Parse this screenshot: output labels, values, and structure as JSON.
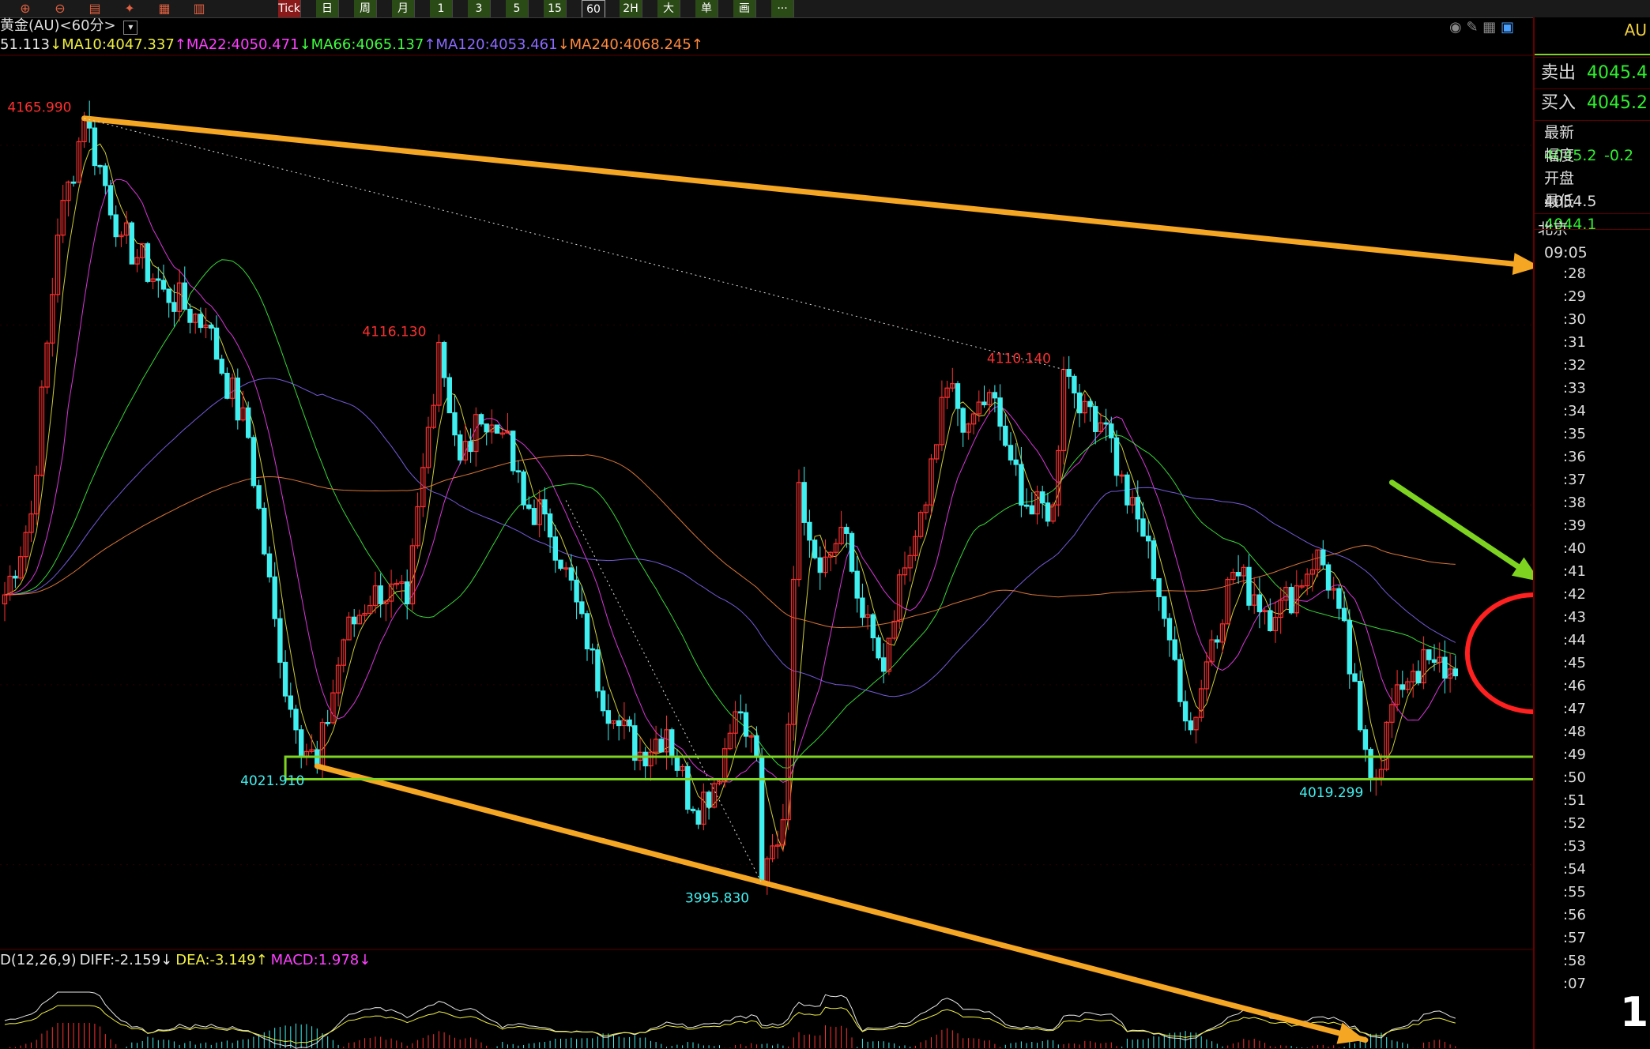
{
  "toolbar": {
    "buttons": [
      "Tick",
      "日",
      "周",
      "月",
      "1",
      "3",
      "5",
      "15",
      "60",
      "2H",
      "大",
      "单",
      "画",
      "···"
    ]
  },
  "header": {
    "title": "黄金(AU)<60分>",
    "ma": [
      {
        "text": "51.113",
        "color": "#e8e8e8"
      },
      {
        "text": "↓MA10:4047.337",
        "color": "#f0f040"
      },
      {
        "text": "↑MA22:4050.471",
        "color": "#ff40ff"
      },
      {
        "text": "↓MA66:4065.137",
        "color": "#40ff40"
      },
      {
        "text": "↑MA120:4053.461",
        "color": "#8a6aff"
      },
      {
        "text": "↓MA240:4068.245↑",
        "color": "#ff8a40"
      }
    ]
  },
  "macd_header": [
    {
      "text": "D(12,26,9)",
      "color": "#e8e8e8"
    },
    {
      "text": "DIFF:-2.159↓",
      "color": "#e8e8e8"
    },
    {
      "text": "DEA:-3.149↑",
      "color": "#f0f040"
    },
    {
      "text": "MACD:1.978↓",
      "color": "#ff40ff"
    }
  ],
  "right_panel": {
    "symbol": "AU",
    "rows": [
      {
        "label": "卖出",
        "value": "4045.4"
      },
      {
        "label": "买入",
        "value": "4045.2"
      }
    ],
    "stats": [
      {
        "label": "最新",
        "value": "4045.2",
        "color": "green"
      },
      {
        "label": "幅度",
        "value": "-0.2",
        "color": "green"
      },
      {
        "label": "开盘",
        "value": "4054.5",
        "color": "white"
      },
      {
        "label": "最低",
        "value": "4044.1",
        "color": "green"
      }
    ],
    "location": "北京",
    "time": "09:05",
    "minutes": [
      ":28",
      ":29",
      ":30",
      ":31",
      ":32",
      ":33",
      ":34",
      ":35",
      ":36",
      ":37",
      ":38",
      ":39",
      ":40",
      ":41",
      ":42",
      ":43",
      ":44",
      ":45",
      ":46",
      ":47",
      ":48",
      ":49",
      ":50",
      ":51",
      ":52",
      ":53",
      ":54",
      ":55",
      ":56",
      ":57",
      ":58",
      ":07"
    ],
    "watermark": "1"
  },
  "chart_data": {
    "type": "candlestick",
    "symbol": "黄金(AU)",
    "period": "60分",
    "ylim": [
      3985,
      4180
    ],
    "annotations": [
      {
        "label": "4165.990",
        "value": 4165.99,
        "index": 15,
        "kind": "high"
      },
      {
        "label": "4116.130",
        "value": 4116.13,
        "index": 82,
        "kind": "high"
      },
      {
        "label": "4110.140",
        "value": 4110.14,
        "index": 200,
        "kind": "high"
      },
      {
        "label": "4021.910",
        "value": 4021.91,
        "index": 59,
        "kind": "low"
      },
      {
        "label": "3995.830",
        "value": 3995.83,
        "index": 143,
        "kind": "low"
      },
      {
        "label": "4019.299",
        "value": 4019.299,
        "index": 259,
        "kind": "low"
      }
    ],
    "path": [
      [
        0,
        4060
      ],
      [
        5,
        4078
      ],
      [
        10,
        4140
      ],
      [
        15,
        4165.99
      ],
      [
        22,
        4140
      ],
      [
        30,
        4128
      ],
      [
        38,
        4120
      ],
      [
        46,
        4095
      ],
      [
        52,
        4045
      ],
      [
        55,
        4030
      ],
      [
        59,
        4021.91
      ],
      [
        64,
        4050
      ],
      [
        70,
        4062
      ],
      [
        76,
        4058
      ],
      [
        82,
        4116.13
      ],
      [
        86,
        4090
      ],
      [
        90,
        4098
      ],
      [
        94,
        4096
      ],
      [
        98,
        4080
      ],
      [
        102,
        4078
      ],
      [
        106,
        4066
      ],
      [
        110,
        4048
      ],
      [
        115,
        4032
      ],
      [
        120,
        4025
      ],
      [
        125,
        4030
      ],
      [
        130,
        4012
      ],
      [
        134,
        4018
      ],
      [
        138,
        4034
      ],
      [
        142,
        4024
      ],
      [
        143,
        3995.83
      ],
      [
        147,
        4010
      ],
      [
        150,
        4085
      ],
      [
        154,
        4065
      ],
      [
        158,
        4075
      ],
      [
        162,
        4055
      ],
      [
        166,
        4043
      ],
      [
        170,
        4066
      ],
      [
        174,
        4080
      ],
      [
        178,
        4106
      ],
      [
        182,
        4098
      ],
      [
        186,
        4105
      ],
      [
        190,
        4090
      ],
      [
        194,
        4078
      ],
      [
        198,
        4080
      ],
      [
        200,
        4110.14
      ],
      [
        204,
        4103
      ],
      [
        208,
        4098
      ],
      [
        212,
        4080
      ],
      [
        216,
        4072
      ],
      [
        220,
        4050
      ],
      [
        224,
        4030
      ],
      [
        228,
        4050
      ],
      [
        232,
        4065
      ],
      [
        236,
        4060
      ],
      [
        240,
        4055
      ],
      [
        244,
        4062
      ],
      [
        248,
        4070
      ],
      [
        252,
        4057
      ],
      [
        256,
        4030
      ],
      [
        259,
        4019.299
      ],
      [
        263,
        4040
      ],
      [
        266,
        4043
      ],
      [
        270,
        4045
      ],
      [
        274,
        4042
      ]
    ],
    "ma_lines": [
      {
        "name": "MA10",
        "color": "#f0f040",
        "value": 4047.337,
        "smooth": 5
      },
      {
        "name": "MA22",
        "color": "#ff40ff",
        "value": 4050.471,
        "smooth": 12
      },
      {
        "name": "MA66",
        "color": "#40ff40",
        "value": 4065.137,
        "smooth": 35
      },
      {
        "name": "MA120",
        "color": "#8a6aff",
        "value": 4053.461,
        "smooth": 60
      },
      {
        "name": "MA240",
        "color": "#ff8a40",
        "value": 4068.245,
        "smooth": 110
      }
    ],
    "macd": {
      "diff": -2.159,
      "dea": -3.149,
      "macd": 1.978
    },
    "drawings": [
      {
        "kind": "arrow",
        "color": "#f5a623",
        "from": [
          15,
          4165.99
        ],
        "to": [
          290,
          4133
        ]
      },
      {
        "kind": "arrow",
        "color": "#f5a623",
        "from": [
          59,
          4021.91
        ],
        "to": [
          257,
          3961
        ]
      },
      {
        "kind": "arrow",
        "color": "#7ed321",
        "from": [
          262,
          4085
        ],
        "to": [
          290,
          4063
        ]
      },
      {
        "kind": "rect",
        "color": "#7ed321",
        "from": [
          53,
          4024
        ],
        "to": [
          297,
          4019
        ]
      },
      {
        "kind": "ellipse",
        "color": "#ff2020",
        "center": [
          289,
          4047
        ],
        "r": [
          15,
          13
        ]
      }
    ],
    "colors": {
      "up": "#ff3030",
      "down": "#40f0f0",
      "grid": "#5a0000"
    }
  }
}
